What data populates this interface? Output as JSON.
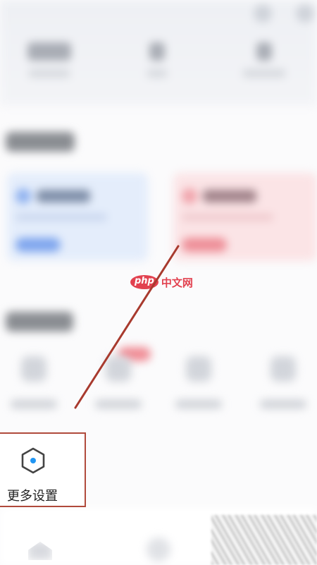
{
  "watermark": {
    "logo": "php",
    "text": "中文网"
  },
  "more_settings": {
    "label": "更多设置",
    "icon": "hexagon-settings-icon",
    "highlight_color": "#b04a3c",
    "dot_color": "#2196f3"
  },
  "pointer_arrow": {
    "color": "#a83a2e"
  }
}
